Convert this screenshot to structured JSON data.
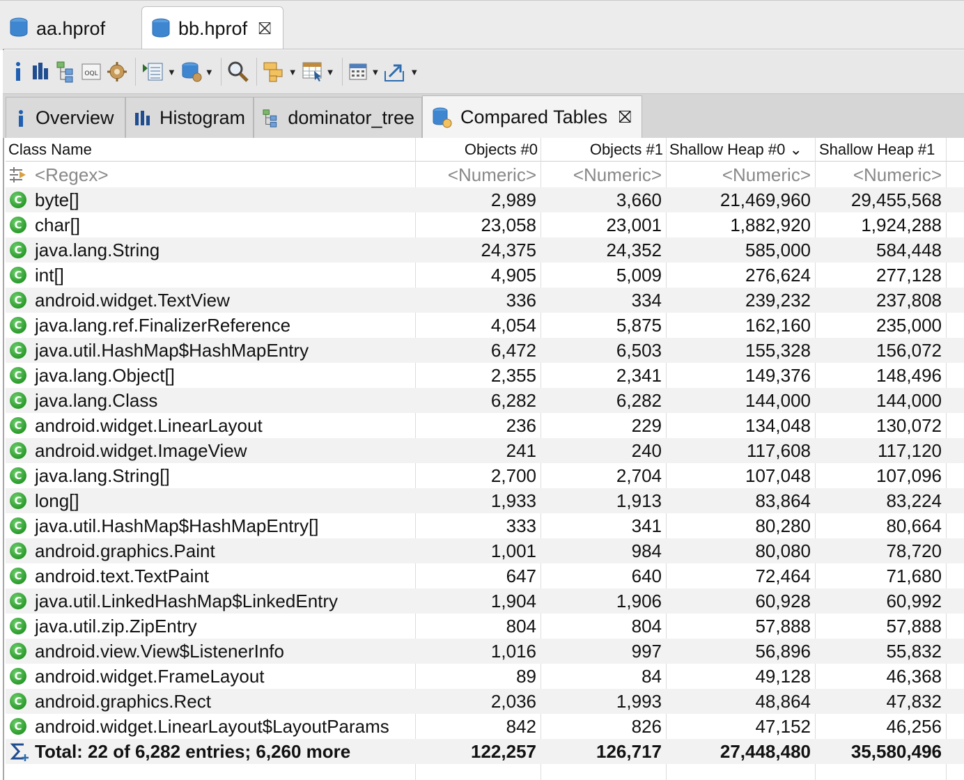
{
  "editor_tabs": [
    {
      "label": "aa.hprof",
      "active": false
    },
    {
      "label": "bb.hprof",
      "active": true,
      "close": "⛝"
    }
  ],
  "toolbar": {
    "icons": [
      "info-icon",
      "histogram-icon",
      "dominator-tree-icon",
      "oql-icon",
      "heap-dump-overview-icon",
      "run-report-icon",
      "query-browser-icon",
      "find-object-icon",
      "group-result-icon",
      "calculate-retained-icon",
      "column-calculator-icon",
      "export-icon"
    ]
  },
  "view_tabs": [
    {
      "label": "Overview",
      "icon": "info-icon"
    },
    {
      "label": "Histogram",
      "icon": "histogram-icon"
    },
    {
      "label": "dominator_tree",
      "icon": "dominator-tree-icon"
    },
    {
      "label": "Compared Tables",
      "icon": "compare-icon",
      "active": true,
      "close": "⛝"
    }
  ],
  "table": {
    "columns": [
      "Class Name",
      "Objects #0",
      "Objects #1",
      "Shallow Heap #0",
      "Shallow Heap #1"
    ],
    "sort_indicator": "⌄",
    "filter_row": [
      "<Regex>",
      "<Numeric>",
      "<Numeric>",
      "<Numeric>",
      "<Numeric>"
    ],
    "rows": [
      [
        "byte[]",
        "2,989",
        "3,660",
        "21,469,960",
        "29,455,568"
      ],
      [
        "char[]",
        "23,058",
        "23,001",
        "1,882,920",
        "1,924,288"
      ],
      [
        "java.lang.String",
        "24,375",
        "24,352",
        "585,000",
        "584,448"
      ],
      [
        "int[]",
        "4,905",
        "5,009",
        "276,624",
        "277,128"
      ],
      [
        "android.widget.TextView",
        "336",
        "334",
        "239,232",
        "237,808"
      ],
      [
        "java.lang.ref.FinalizerReference",
        "4,054",
        "5,875",
        "162,160",
        "235,000"
      ],
      [
        "java.util.HashMap$HashMapEntry",
        "6,472",
        "6,503",
        "155,328",
        "156,072"
      ],
      [
        "java.lang.Object[]",
        "2,355",
        "2,341",
        "149,376",
        "148,496"
      ],
      [
        "java.lang.Class",
        "6,282",
        "6,282",
        "144,000",
        "144,000"
      ],
      [
        "android.widget.LinearLayout",
        "236",
        "229",
        "134,048",
        "130,072"
      ],
      [
        "android.widget.ImageView",
        "241",
        "240",
        "117,608",
        "117,120"
      ],
      [
        "java.lang.String[]",
        "2,700",
        "2,704",
        "107,048",
        "107,096"
      ],
      [
        "long[]",
        "1,933",
        "1,913",
        "83,864",
        "83,224"
      ],
      [
        "java.util.HashMap$HashMapEntry[]",
        "333",
        "341",
        "80,280",
        "80,664"
      ],
      [
        "android.graphics.Paint",
        "1,001",
        "984",
        "80,080",
        "78,720"
      ],
      [
        "android.text.TextPaint",
        "647",
        "640",
        "72,464",
        "71,680"
      ],
      [
        "java.util.LinkedHashMap$LinkedEntry",
        "1,904",
        "1,906",
        "60,928",
        "60,992"
      ],
      [
        "java.util.zip.ZipEntry",
        "804",
        "804",
        "57,888",
        "57,888"
      ],
      [
        "android.view.View$ListenerInfo",
        "1,016",
        "997",
        "56,896",
        "55,832"
      ],
      [
        "android.widget.FrameLayout",
        "89",
        "84",
        "49,128",
        "46,368"
      ],
      [
        "android.graphics.Rect",
        "2,036",
        "1,993",
        "48,864",
        "47,832"
      ],
      [
        "android.widget.LinearLayout$LayoutParams",
        "842",
        "826",
        "47,152",
        "46,256"
      ]
    ],
    "total": [
      "Total: 22 of 6,282 entries; 6,260 more",
      "122,257",
      "126,717",
      "27,448,480",
      "35,580,496"
    ],
    "class_icon_letter": "C"
  }
}
